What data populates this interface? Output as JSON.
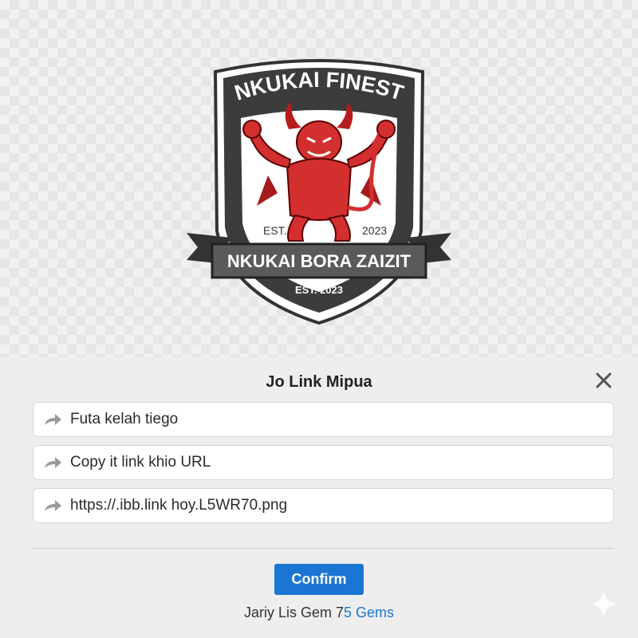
{
  "logo": {
    "top_text": "NKUKAI FINEST",
    "est_left": "EST.",
    "est_right": "2023",
    "banner_text": "NKUKAI BORA ZAIZIT",
    "bottom_est": "EST. 2023",
    "mascot_icon": "red-devil-mascot-icon",
    "colors": {
      "shield": "#3a3a3a",
      "mascot": "#d32f2f",
      "banner": "#555555"
    }
  },
  "sheet": {
    "title": "Jo Link Mipua",
    "close_icon": "close-icon",
    "options": [
      {
        "label": "Futa kelah tiego",
        "icon": "share-arrow-icon"
      },
      {
        "label": "Copy it link khio URL",
        "icon": "share-arrow-icon"
      },
      {
        "label": "https://.ibb.link hoy.L5WR70.png",
        "icon": "share-arrow-icon"
      }
    ],
    "confirm_label": "Confirm",
    "gems_prefix": "Jariy Lis Gem 7",
    "gems_accent": "5 Gems",
    "accent_color": "#1b76d3"
  }
}
